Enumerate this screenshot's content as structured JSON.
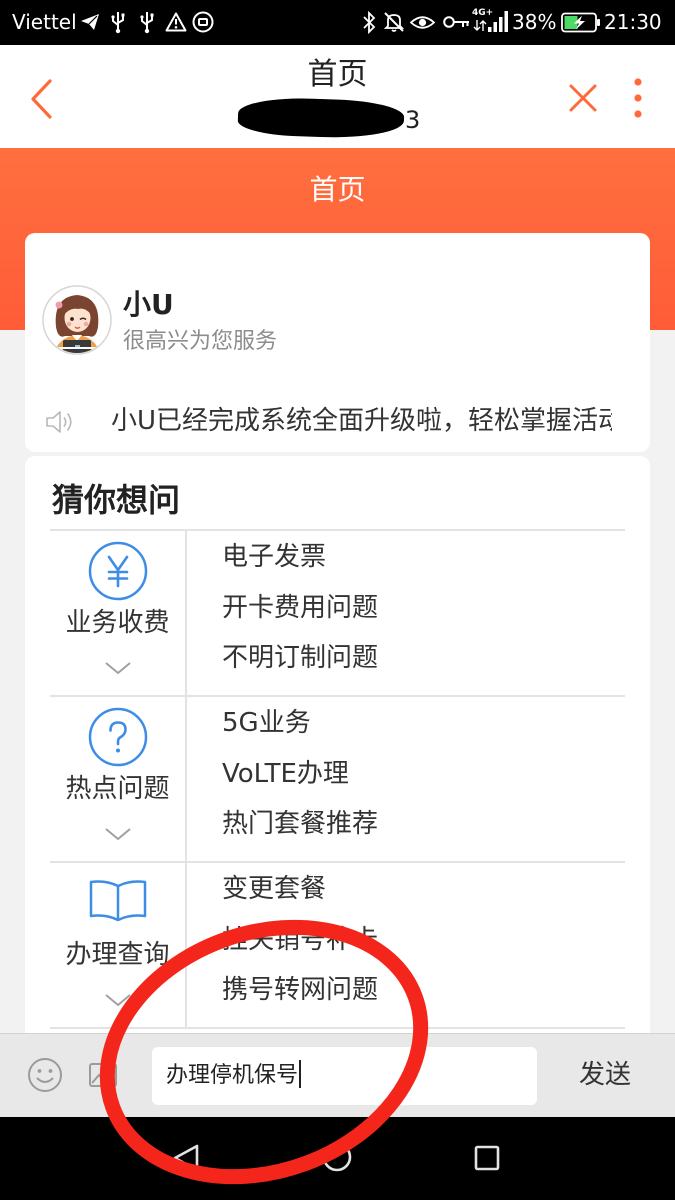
{
  "status_bar": {
    "carrier": "Viettel",
    "network": "4G+",
    "battery": "38%",
    "time": "21:30",
    "left_icons": [
      "telegram-icon",
      "usb-icon",
      "usb-icon",
      "warning-icon",
      "app-notification-icon"
    ],
    "right_icons": [
      "bluetooth-icon",
      "mute-icon",
      "eye-icon",
      "key-icon",
      "signal-icon",
      "battery-charging-icon"
    ]
  },
  "header": {
    "title": "首页",
    "subtitle_visible": "3",
    "back_icon": "chevron-left-icon",
    "close_icon": "close-icon",
    "menu_icon": "more-vertical-icon"
  },
  "banner": {
    "title": "首页"
  },
  "assistant": {
    "name": "小U",
    "tagline": "很高兴为您服务",
    "notice": "小U已经完成系统全面升级啦，轻松掌握活动",
    "notice_icon": "speaker-icon"
  },
  "faq": {
    "title": "猜你想问",
    "categories": [
      {
        "name": "业务收费",
        "icon": "yen-icon",
        "items": [
          "电子发票",
          "开卡费用问题",
          "不明订制问题"
        ]
      },
      {
        "name": "热点问题",
        "icon": "question-icon",
        "items": [
          "5G业务",
          "VoLTE办理",
          "热门套餐推荐"
        ]
      },
      {
        "name": "办理查询",
        "icon": "book-icon",
        "items": [
          "变更套餐",
          "挂失销号补卡",
          "携号转网问题"
        ]
      }
    ]
  },
  "input_bar": {
    "emoji_icon": "smiley-icon",
    "image_icon": "image-icon",
    "value": "办理停机保号",
    "send_label": "发送"
  },
  "nav_bar": {
    "icons": [
      "back-triangle-icon",
      "home-circle-icon",
      "recents-square-icon"
    ]
  },
  "colors": {
    "accent_orange": "#FF6A3B",
    "icon_blue": "#3D8DE6",
    "annotation_red": "#F4261B",
    "page_background": "#F2F2F2"
  }
}
